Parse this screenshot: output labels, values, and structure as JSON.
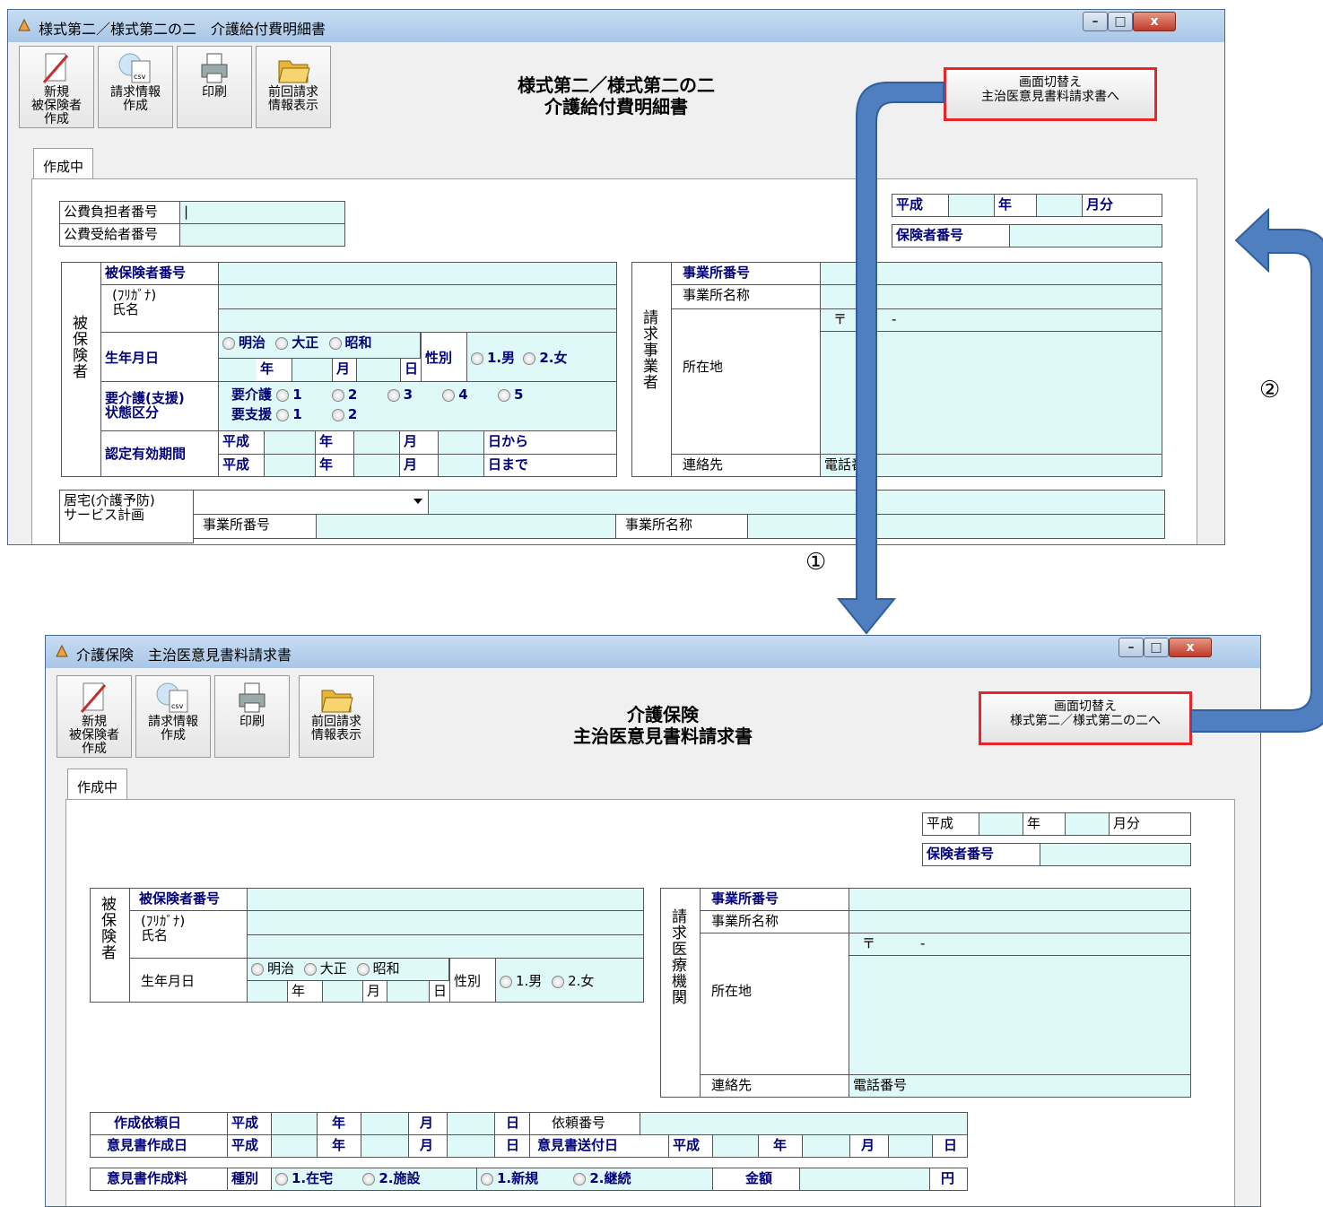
{
  "window1": {
    "title": "様式第二／様式第二の二　介護給付費明細書",
    "toolbar": {
      "new_label": "新規\n被保険者\n作成",
      "billing_label": "請求情報\n作成",
      "print_label": "印刷",
      "previous_label": "前回請求\n情報表示"
    },
    "heading": {
      "line1": "様式第二／様式第二の二",
      "line2": "介護給付費明細書"
    },
    "switch_button": {
      "line1": "画面切替え",
      "line2": "主治医意見書料請求書へ"
    },
    "tab_label": "作成中",
    "public": {
      "payer_label": "公費負担者番号",
      "payer_value": "|",
      "recipient_label": "公費受給者番号"
    },
    "period": {
      "era": "平成",
      "year": "年",
      "month": "月分"
    },
    "insurer_label": "保険者番号",
    "insured": {
      "group_label": "被保険者",
      "number_label": "被保険者番号",
      "kana_label": "(ﾌﾘｶﾞﾅ)",
      "name_label": "氏名",
      "birth_label": "生年月日",
      "eras": [
        "明治",
        "大正",
        "昭和"
      ],
      "year": "年",
      "month": "月",
      "day": "日",
      "gender_label": "性別",
      "genders": [
        "1.男",
        "2.女"
      ],
      "care_label1": "要介護(支援)",
      "care_label2": "状態区分",
      "care_level_label": "要介護",
      "care_levels": [
        "1",
        "2",
        "3",
        "4",
        "5"
      ],
      "support_label": "要支援",
      "support_levels": [
        "1",
        "2"
      ],
      "cert_label": "認定有効期間",
      "era": "平成",
      "from": "日から",
      "to": "日まで"
    },
    "provider": {
      "group_label": "請求事業者",
      "number_label": "事業所番号",
      "name_label": "事業所名称",
      "address_label": "所在地",
      "postal": "〒",
      "dash": "-",
      "contact_label": "連絡先",
      "phone_label": "電話番号"
    },
    "plan": {
      "label1": "居宅(介護予防)",
      "label2": "サービス計画",
      "office_number_label": "事業所番号",
      "office_name_label": "事業所名称"
    }
  },
  "window2": {
    "title": "介護保険　主治医意見書料請求書",
    "toolbar": {
      "new_label": "新規\n被保険者\n作成",
      "billing_label": "請求情報\n作成",
      "print_label": "印刷",
      "previous_label": "前回請求\n情報表示"
    },
    "heading": {
      "line1": "介護保険",
      "line2": "主治医意見書料請求書"
    },
    "switch_button": {
      "line1": "画面切替え",
      "line2": "様式第二／様式第二の二へ"
    },
    "tab_label": "作成中",
    "period": {
      "era": "平成",
      "year": "年",
      "month": "月分"
    },
    "insurer_label": "保険者番号",
    "insured": {
      "group_label": "被保険者",
      "number_label": "被保険者番号",
      "kana_label": "(ﾌﾘｶﾞﾅ)",
      "name_label": "氏名",
      "birth_label": "生年月日",
      "eras": [
        "明治",
        "大正",
        "昭和"
      ],
      "year": "年",
      "month": "月",
      "day": "日",
      "gender_label": "性別",
      "genders": [
        "1.男",
        "2.女"
      ]
    },
    "provider": {
      "group_label": "請求医療機関",
      "number_label": "事業所番号",
      "name_label": "事業所名称",
      "address_label": "所在地",
      "postal": "〒",
      "dash": "-",
      "contact_label": "連絡先",
      "phone_label": "電話番号"
    },
    "request": {
      "request_date_label": "作成依頼日",
      "request_no_label": "依頼番号",
      "created_date_label": "意見書作成日",
      "sent_date_label": "意見書送付日",
      "fee_label": "意見書作成料",
      "kind_label": "種別",
      "kinds": [
        "1.在宅",
        "2.施設"
      ],
      "types": [
        "1.新規",
        "2.継続"
      ],
      "amount_label": "金額",
      "yen": "円",
      "era": "平成",
      "year": "年",
      "month": "月",
      "day": "日"
    }
  },
  "annotations": {
    "step1": "①",
    "step2": "②"
  },
  "colors": {
    "cell_fill": "#dff8f8",
    "highlight_border": "#e8262a",
    "arrow_fill": "#4f7fbf",
    "label_blue": "#00007a"
  }
}
